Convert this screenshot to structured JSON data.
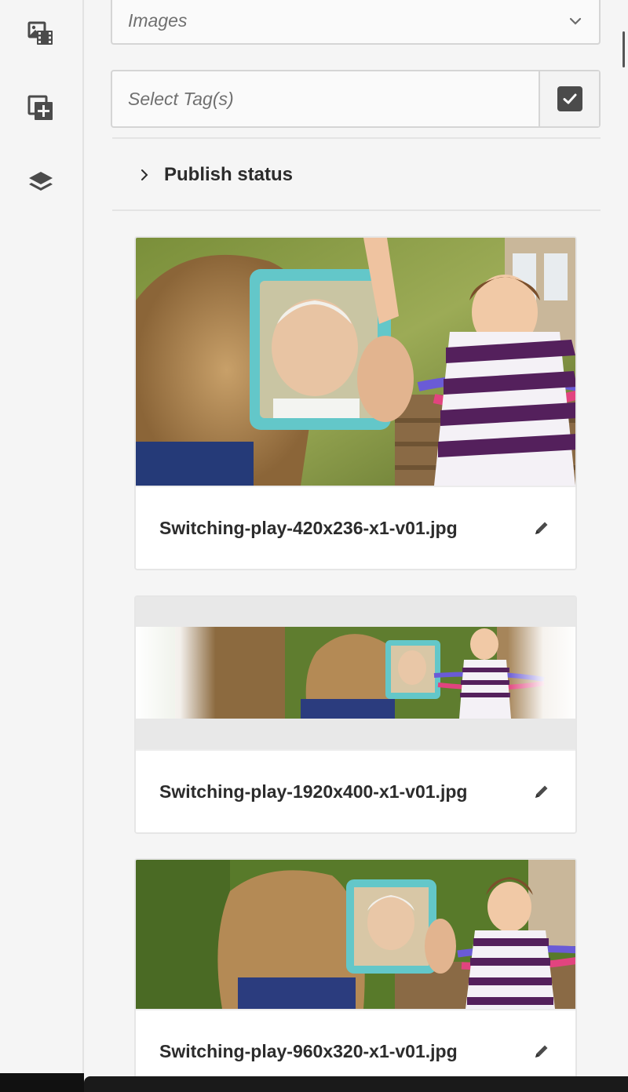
{
  "rail": {
    "items": [
      {
        "icon": "asset-media-icon"
      },
      {
        "icon": "add-component-icon"
      },
      {
        "icon": "layers-icon"
      }
    ]
  },
  "filters": {
    "type_select_value": "Images",
    "tags_placeholder": "Select Tag(s)"
  },
  "publish": {
    "label": "Publish status"
  },
  "assets": [
    {
      "name": "Switching-play-420x236-x1-v01.jpg"
    },
    {
      "name": "Switching-play-1920x400-x1-v01.jpg"
    },
    {
      "name": "Switching-play-960x320-x1-v01.jpg"
    }
  ],
  "colors": {
    "accent_dark": "#4b4b4b",
    "border": "#d5d5d5",
    "background": "#f5f5f5"
  }
}
